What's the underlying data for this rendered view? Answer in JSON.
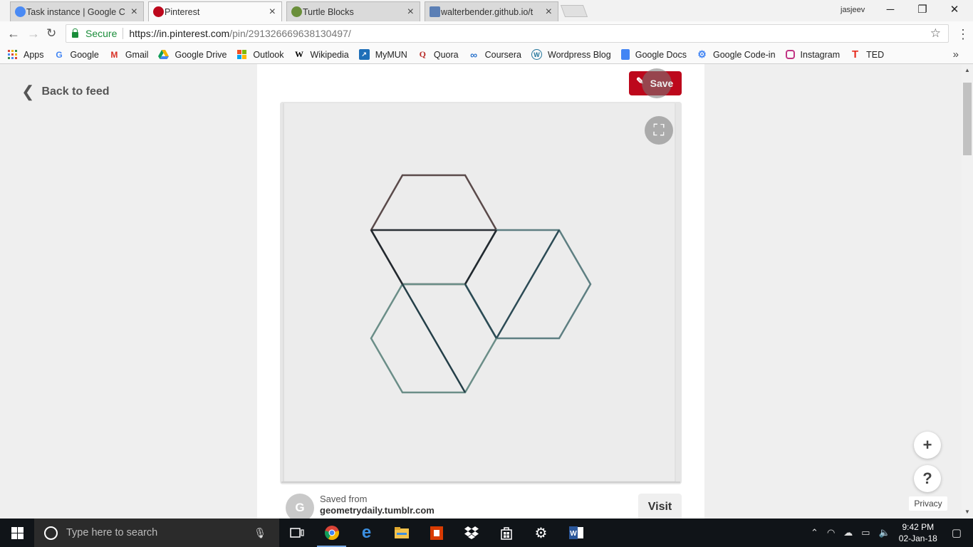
{
  "tabs": [
    {
      "title": "Task instance | Google C",
      "favicon_color": "#4a8af4",
      "icon": "google-codein-icon"
    },
    {
      "title": "Pinterest",
      "favicon_color": "#bd081c",
      "icon": "pinterest-icon"
    },
    {
      "title": "Turtle Blocks",
      "favicon_color": "#6a8f3a",
      "icon": "turtle-icon"
    },
    {
      "title": "walterbender.github.io/t",
      "favicon_color": "#5b7fb5",
      "icon": "avatar-icon"
    }
  ],
  "profile_name": "jasjeev",
  "window_controls": {
    "minimize": "─",
    "restore": "❐",
    "close": "✕"
  },
  "address": {
    "secure_label": "Secure",
    "url_scheme_host": "https://in.pinterest.com",
    "url_path": "/pin/291326669638130497/"
  },
  "bookmarks": [
    {
      "label": "Apps",
      "icon": "apps-icon",
      "color": "#d33"
    },
    {
      "label": "Google",
      "icon": "google-icon",
      "color": "#4285f4"
    },
    {
      "label": "Gmail",
      "icon": "gmail-icon",
      "color": "#d93025"
    },
    {
      "label": "Google Drive",
      "icon": "drive-icon",
      "color": "#0f9d58"
    },
    {
      "label": "Outlook",
      "icon": "outlook-icon",
      "color": "#f25022"
    },
    {
      "label": "Wikipedia",
      "icon": "wikipedia-icon",
      "color": "#000"
    },
    {
      "label": "MyMUN",
      "icon": "mymun-icon",
      "color": "#1e6fb8"
    },
    {
      "label": "Quora",
      "icon": "quora-icon",
      "color": "#b92b27"
    },
    {
      "label": "Coursera",
      "icon": "coursera-icon",
      "color": "#2a73cc"
    },
    {
      "label": "Wordpress Blog",
      "icon": "wordpress-icon",
      "color": "#21759b"
    },
    {
      "label": "Google Docs",
      "icon": "docs-icon",
      "color": "#4285f4"
    },
    {
      "label": "Google Code-in",
      "icon": "codein-icon",
      "color": "#4285f4"
    },
    {
      "label": "Instagram",
      "icon": "instagram-icon",
      "color": "#c13584"
    },
    {
      "label": "TED",
      "icon": "ted-icon",
      "color": "#e62b1e"
    }
  ],
  "page": {
    "back_label": "Back to feed",
    "save_label": "Save",
    "source_label": "Saved from",
    "source_site": "geometrydaily.tumblr.com",
    "source_initial": "G",
    "visit_label": "Visit",
    "privacy_label": "Privacy",
    "plus_label": "+",
    "help_label": "?"
  },
  "taskbar": {
    "search_placeholder": "Type here to search",
    "time": "9:42 PM",
    "date": "02-Jan-18"
  },
  "colors": {
    "pinterest_red": "#bd081c",
    "secure_green": "#1a8d3a"
  }
}
